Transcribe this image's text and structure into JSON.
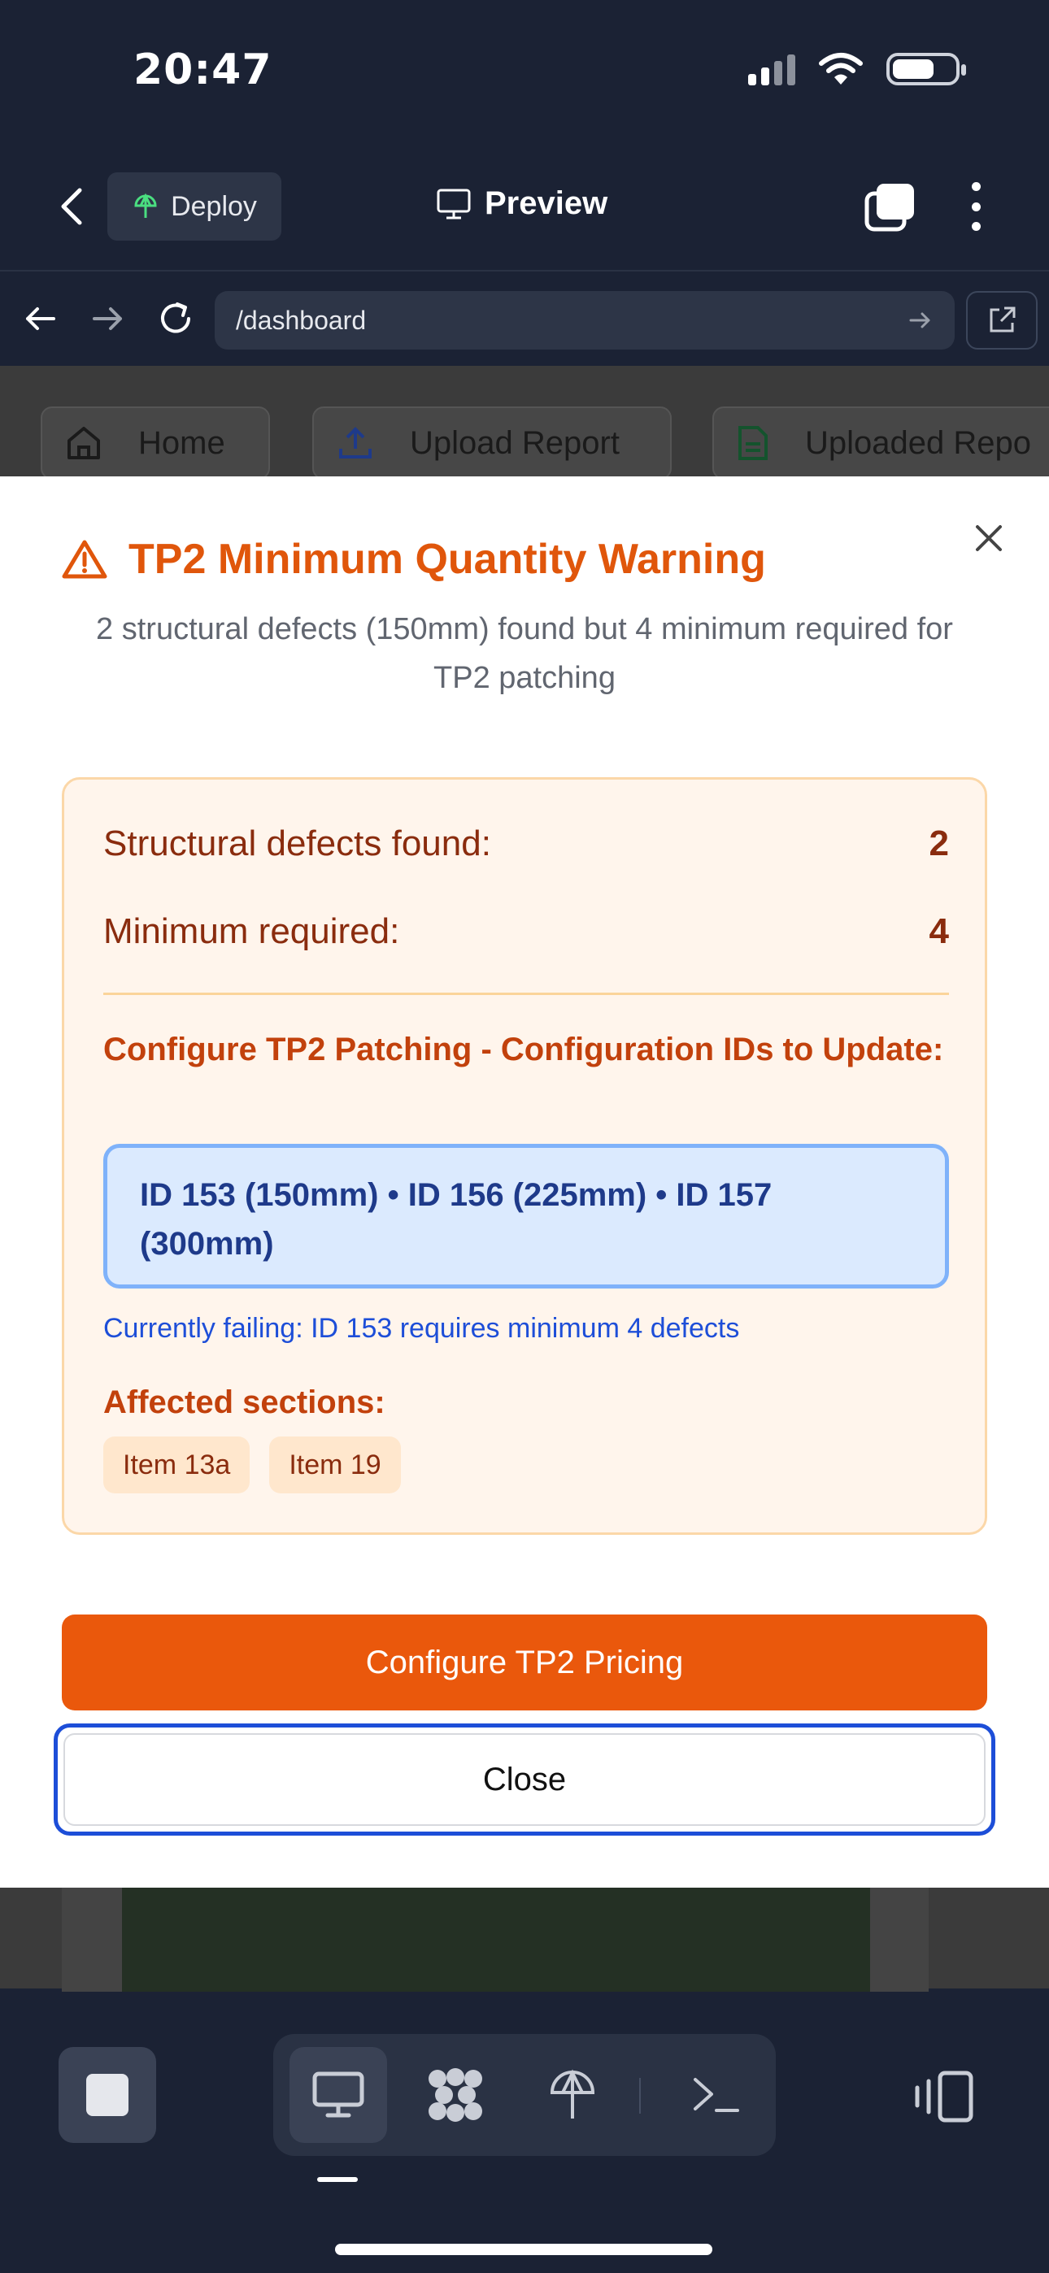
{
  "status_bar": {
    "time": "20:47"
  },
  "app_header": {
    "deploy_label": "Deploy",
    "preview_label": "Preview"
  },
  "url_bar": {
    "url": "/dashboard"
  },
  "page_tabs": [
    {
      "label": "Home",
      "icon": "home-icon"
    },
    {
      "label": "Upload Report",
      "icon": "upload-icon"
    },
    {
      "label": "Uploaded Repo",
      "icon": "document-icon"
    }
  ],
  "modal": {
    "title": "TP2 Minimum Quantity Warning",
    "subtitle": "2 structural defects (150mm) found but 4 minimum required for TP2 patching",
    "defects_found_label": "Structural defects found:",
    "defects_found_value": "2",
    "minimum_required_label": "Minimum required:",
    "minimum_required_value": "4",
    "config_title": "Configure TP2 Patching - Configuration IDs to Update:",
    "config_ids": "ID 153 (150mm) • ID 156 (225mm) • ID 157 (300mm)",
    "failing_text": "Currently failing: ID 153 requires minimum 4 defects",
    "affected_title": "Affected sections:",
    "affected_items": [
      "Item 13a",
      "Item 19"
    ],
    "primary_button": "Configure TP2 Pricing",
    "secondary_button": "Close"
  },
  "colors": {
    "accent_orange": "#ea580c",
    "warning_text": "#8a2c0e",
    "focus_blue": "#1d4ed8",
    "header_bg": "#1b2234"
  }
}
